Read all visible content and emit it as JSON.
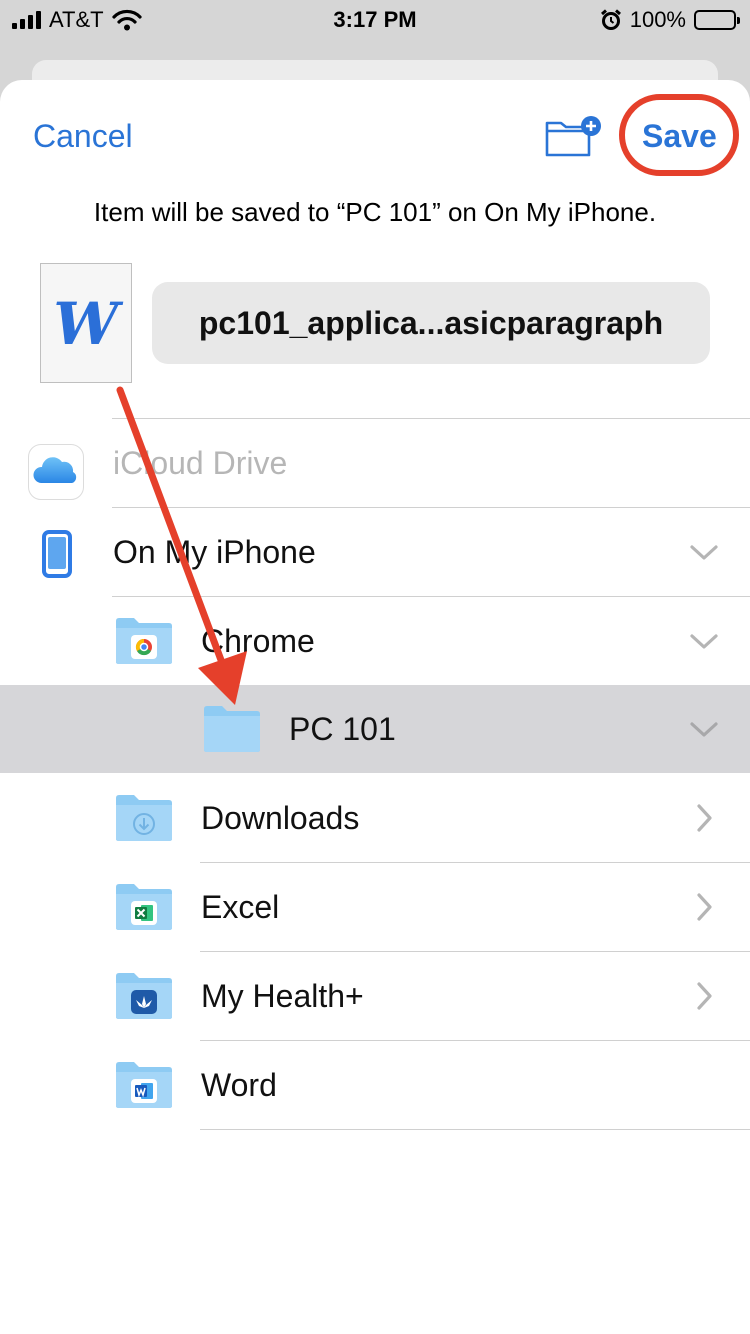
{
  "status_bar": {
    "carrier": "AT&T",
    "time": "3:17 PM",
    "battery": "100%"
  },
  "header": {
    "cancel_label": "Cancel",
    "save_label": "Save"
  },
  "info_text": "Item will be saved to “PC 101” on On My iPhone.",
  "document": {
    "icon_letter": "W",
    "filename": "pc101_applica...asicparagraph"
  },
  "locations": [
    {
      "label": "iCloud Drive",
      "icon": "icloud-icon",
      "state": "disabled"
    },
    {
      "label": "On My iPhone",
      "icon": "phone-icon",
      "chevron": "down"
    },
    {
      "label": "Chrome",
      "icon": "chrome-folder-icon",
      "chevron": "down"
    },
    {
      "label": "PC 101",
      "icon": "folder-icon",
      "chevron": "down",
      "state": "selected"
    },
    {
      "label": "Downloads",
      "icon": "downloads-folder-icon",
      "chevron": "right"
    },
    {
      "label": "Excel",
      "icon": "excel-folder-icon",
      "chevron": "right"
    },
    {
      "label": "My Health+",
      "icon": "myhealth-folder-icon",
      "chevron": "right"
    },
    {
      "label": "Word",
      "icon": "word-folder-icon"
    }
  ],
  "colors": {
    "accent": "#2a74d6",
    "annotation": "#e5402b",
    "folder": "#8ecbf3",
    "selected_row": "#d6d6d9"
  }
}
